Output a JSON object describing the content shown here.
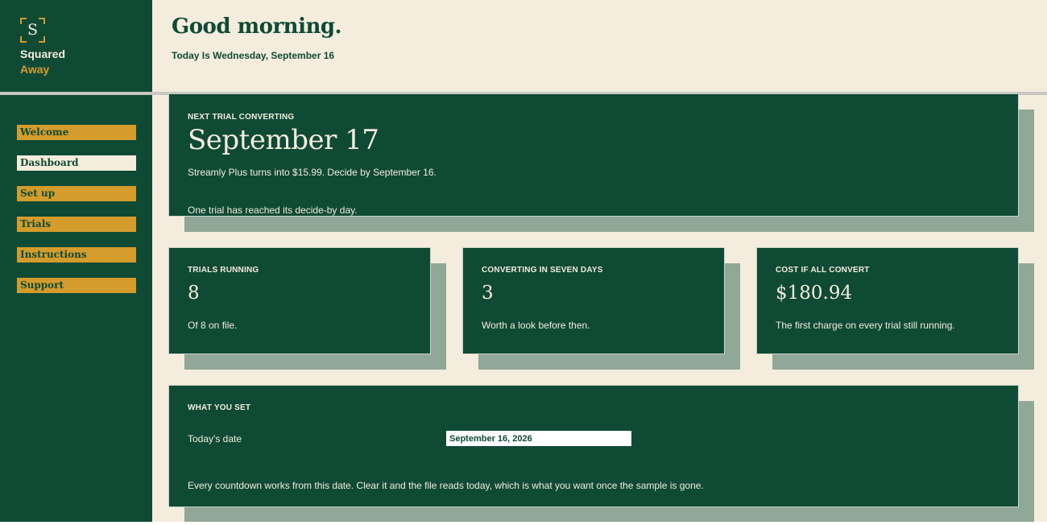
{
  "brand": {
    "logo_letter": "S",
    "line1": "Squared",
    "line2": "Away",
    "accent": "#d49c2c",
    "primary": "#0f4a35",
    "background": "#f4eddd"
  },
  "nav": {
    "items": [
      {
        "label": "Welcome"
      },
      {
        "label": "Dashboard"
      },
      {
        "label": "Set up"
      },
      {
        "label": "Trials"
      },
      {
        "label": "Instructions"
      },
      {
        "label": "Support"
      }
    ]
  },
  "header": {
    "greeting": "Good morning.",
    "today": "Today Is Wednesday, September 16"
  },
  "next_trial": {
    "label": "NEXT TRIAL CONVERTING",
    "date": "September 17",
    "detail": "Streamly Plus turns into $15.99. Decide by September 16.",
    "note": "One trial has reached its decide-by day."
  },
  "stats": [
    {
      "label": "TRIALS RUNNING",
      "value": "8",
      "caption": "Of 8 on file."
    },
    {
      "label": "CONVERTING IN SEVEN DAYS",
      "value": "3",
      "caption": "Worth a look before then."
    },
    {
      "label": "COST IF ALL CONVERT",
      "value": "$180.94",
      "caption": "The first charge on every trial still running."
    }
  ],
  "settings": {
    "label": "WHAT YOU SET",
    "date_label": "Today's date",
    "date_value": "September 16, 2026",
    "note": "Every countdown works from this date. Clear it and the file reads today, which is what you want once the sample is gone."
  }
}
